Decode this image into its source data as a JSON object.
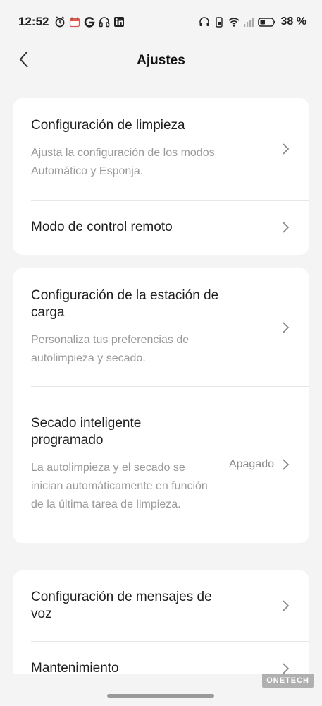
{
  "status_bar": {
    "time": "12:52",
    "left_icons": [
      "alarm-icon",
      "calendar-icon",
      "g-app-icon",
      "headphones-icon",
      "linkedin-icon"
    ],
    "right_icons": [
      "earbuds-icon",
      "wifi-icon",
      "signal-icon",
      "battery-icon"
    ],
    "battery": "38 %"
  },
  "header": {
    "title": "Ajustes"
  },
  "sections": {
    "cleaning": {
      "title": "Configuración de limpieza",
      "desc": "Ajusta la configuración de los modos Automático y Esponja."
    },
    "remote": {
      "title": "Modo de control remoto"
    },
    "station": {
      "title": "Configuración de la estación de carga",
      "desc": "Personaliza tus preferencias de autolimpieza y secado."
    },
    "smart_dry": {
      "title": "Secado inteligente programado",
      "desc": "La autolimpieza y el secado se inician automáticamente en función de la última tarea de limpieza.",
      "value": "Apagado"
    },
    "voice": {
      "title": "Configuración de mensajes de voz"
    },
    "maintenance": {
      "title": "Mantenimiento"
    }
  },
  "watermark": "ONETECH",
  "colors": {
    "background": "#f4f4f4",
    "card": "#ffffff",
    "secondary_text": "#9a9a9a"
  }
}
